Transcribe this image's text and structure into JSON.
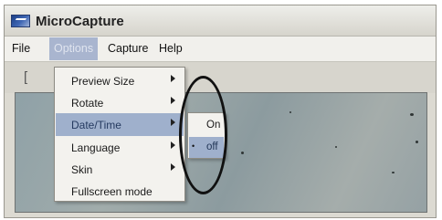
{
  "window": {
    "title": "MicroCapture",
    "icon": "microcapture-app-icon"
  },
  "menubar": {
    "items": [
      {
        "label": "File"
      },
      {
        "label": "Options",
        "active": true
      },
      {
        "label": "Capture"
      },
      {
        "label": "Help"
      }
    ]
  },
  "toolbar": {
    "glyph": "["
  },
  "options_menu": {
    "items": [
      {
        "label": "Preview Size",
        "submenu": true
      },
      {
        "label": "Rotate",
        "submenu": true
      },
      {
        "label": "Date/Time",
        "submenu": true,
        "highlighted": true
      },
      {
        "label": "Language",
        "submenu": true
      },
      {
        "label": "Skin",
        "submenu": true
      },
      {
        "label": "Fullscreen mode",
        "submenu": false
      }
    ]
  },
  "datetime_submenu": {
    "items": [
      {
        "label": "On",
        "checked": false
      },
      {
        "label": "off",
        "checked": true,
        "highlighted": true
      }
    ],
    "check_mark": "•"
  },
  "colors": {
    "highlight": "#9fb0cc",
    "annotation": "#111111"
  }
}
